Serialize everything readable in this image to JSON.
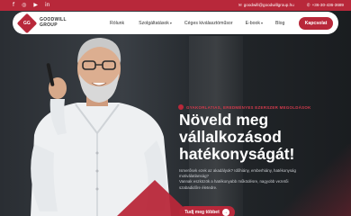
{
  "topbar": {
    "social": [
      "f",
      "◎",
      "▶",
      "in"
    ],
    "email": "goodwill@goodwillgroup.hu",
    "phone": "+36-30-436-3689",
    "email_icon": "✉",
    "phone_icon": "✆"
  },
  "nav": {
    "logo_mark": "GG",
    "logo_line1": "GOODWILL",
    "logo_line2": "GROUP",
    "items": [
      "Rólunk",
      "Szolgáltatások",
      "Céges kiválasztóműsor",
      "E-book",
      "Blog"
    ],
    "caret": "▾",
    "cta": "Kapcsolat"
  },
  "hero": {
    "badge": "GYAKORLATIAS, EREDMÉNYES EZERSZER MEGOLDÁSOK",
    "headline_line1": "Növeld meg",
    "headline_line2": "vállalkozásod",
    "headline_line3": "hatékonyságát!",
    "body_line1": "Ismerősek ezek az akadályok? Időhiány, emberhiány, hatékonyság",
    "body_line2": "motiválatlanság?",
    "body_line3": "Vannak eszközök a hatékonyabb működésre, nagyobb vezetői",
    "body_line4": "szabadidőre életedre.",
    "button": "Tudj meg többet",
    "button_arrow": "→"
  },
  "colors": {
    "accent": "#b8283a",
    "dark": "#171a1d"
  }
}
